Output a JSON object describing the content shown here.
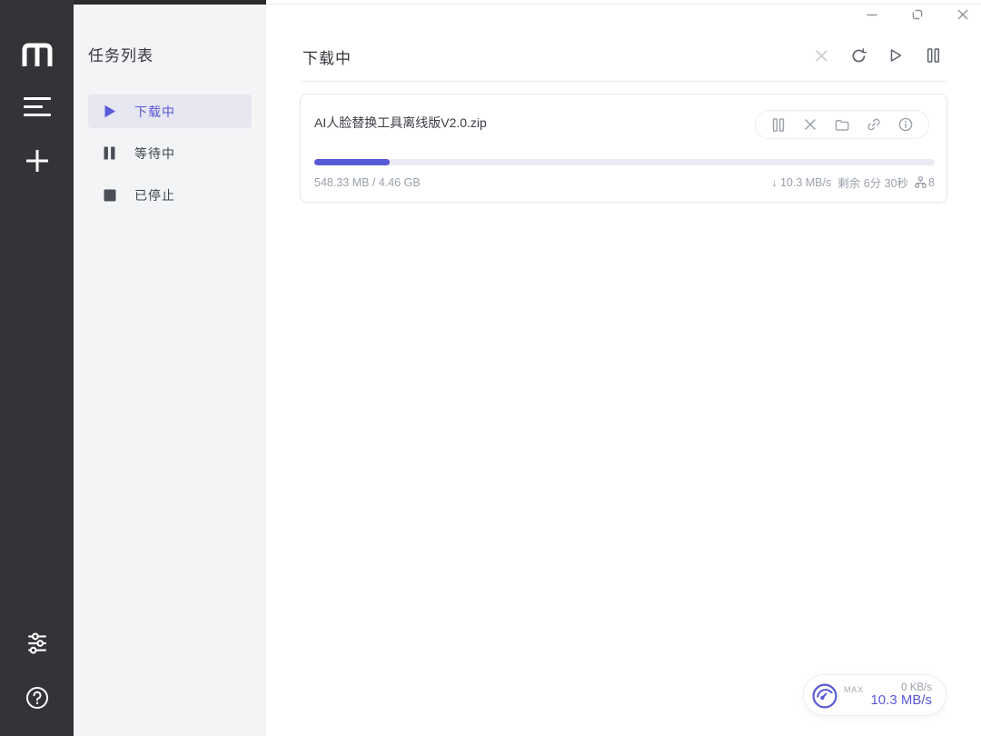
{
  "colors": {
    "accent": "#585ad8",
    "sidebar_bg": "#333438",
    "panel_bg": "#f3f4f6",
    "progress_track": "#e9eaf3"
  },
  "sidebar": {
    "logo_icon": "motrix-m-logo",
    "icons": [
      "task-list-icon",
      "add-task-icon",
      "preferences-icon",
      "help-icon"
    ]
  },
  "task_panel": {
    "title": "任务列表",
    "items": [
      {
        "label": "下载中",
        "icon": "play-icon",
        "active": true
      },
      {
        "label": "等待中",
        "icon": "pause-icon",
        "active": false
      },
      {
        "label": "已停止",
        "icon": "stop-icon",
        "active": false
      }
    ]
  },
  "header": {
    "title": "下载中",
    "toolbar_icons": [
      "delete-icon",
      "refresh-icon",
      "resume-all-icon",
      "pause-all-icon"
    ]
  },
  "task": {
    "filename": "AI人脸替换工具离线版V2.0.zip",
    "action_icons": [
      "pause-icon",
      "delete-icon",
      "open-folder-icon",
      "copy-link-icon",
      "info-icon"
    ],
    "progress_percent": 12.2,
    "size_text": "548.33 MB / 4.46 GB",
    "speed_text": "↓ 10.3 MB/s",
    "remaining_text": "剩余 6分 30秒",
    "connections_count": "8"
  },
  "speed_widget": {
    "max_label": "MAX",
    "upload_speed": "0 KB/s",
    "download_speed": "10.3 MB/s"
  },
  "window_controls": [
    "minimize-icon",
    "maximize-icon",
    "close-icon"
  ]
}
